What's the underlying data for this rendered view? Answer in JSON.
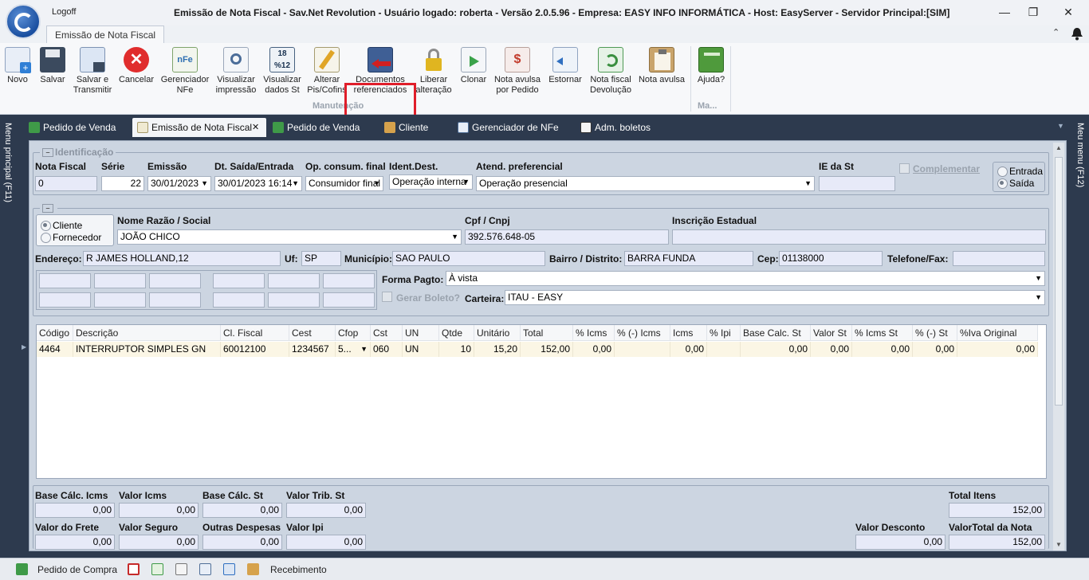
{
  "titlebar": {
    "logoff": "Logoff",
    "title": "Emissão de Nota Fiscal - Sav.Net Revolution - Usuário logado: roberta - Versão 2.0.5.96 - Empresa: EASY INFO INFORMÁTICA - Host: EasyServer - Servidor Principal:[SIM]",
    "minimize": "—",
    "restore": "❐",
    "close": "✕"
  },
  "ribbon": {
    "tab": "Emissão de Nota Fiscal",
    "collapse": "⌃",
    "buttons": [
      {
        "l1": "Novo",
        "l2": ""
      },
      {
        "l1": "Salvar",
        "l2": ""
      },
      {
        "l1": "Salvar e",
        "l2": "Transmitir"
      },
      {
        "l1": "Cancelar",
        "l2": ""
      },
      {
        "l1": "Gerenciador",
        "l2": "NFe"
      },
      {
        "l1": "Visualizar",
        "l2": "impressão"
      },
      {
        "l1": "Visualizar",
        "l2": "dados St"
      },
      {
        "l1": "Alterar",
        "l2": "Pis/Cofins"
      },
      {
        "l1": "Documentos",
        "l2": "referenciados"
      },
      {
        "l1": "Liberar",
        "l2": "alteração"
      },
      {
        "l1": "Clonar",
        "l2": ""
      },
      {
        "l1": "Nota avulsa",
        "l2": "por Pedido"
      },
      {
        "l1": "Estornar",
        "l2": ""
      },
      {
        "l1": "Nota fiscal",
        "l2": "Devolução"
      },
      {
        "l1": "Nota avulsa",
        "l2": ""
      },
      {
        "l1": "Ajuda?",
        "l2": ""
      }
    ],
    "groups": {
      "main": "Manutenção",
      "help": "Ma..."
    }
  },
  "doc_tabs": [
    {
      "label": "Pedido de Venda"
    },
    {
      "label": "Emissão de Nota Fiscal",
      "close": "✕"
    },
    {
      "label": "Pedido de Venda"
    },
    {
      "label": "Cliente"
    },
    {
      "label": "Gerenciador de NFe"
    },
    {
      "label": "Adm. boletos"
    }
  ],
  "side": {
    "left": "Menu principal (F11)",
    "right": "Meu menu (F12)"
  },
  "identificacao": {
    "legend": "Identificação",
    "nota_fiscal_label": "Nota Fiscal",
    "nota_fiscal": "0",
    "serie_label": "Série",
    "serie": "22",
    "emissao_label": "Emissão",
    "emissao": "30/01/2023",
    "saida_label": "Dt. Saída/Entrada",
    "saida": "30/01/2023 16:14",
    "op_consum_label": "Op. consum. final",
    "op_consum": "Consumidor final",
    "ident_dest_label": "Ident.Dest.",
    "ident_dest": "Operação interna",
    "atend_label": "Atend. preferencial",
    "atend": "Operação presencial",
    "ie_st_label": "IE da St",
    "ie_st": "",
    "complementar": "Complementar",
    "entrada": "Entrada",
    "saida_radio": "Saída"
  },
  "destinatario": {
    "cliente": "Cliente",
    "fornecedor": "Fornecedor",
    "nome_label": "Nome Razão / Social",
    "nome": "JOÃO CHICO",
    "cpf_label": "Cpf / Cnpj",
    "cpf": "392.576.648-05",
    "ie_label": "Inscrição Estadual",
    "ie": "",
    "endereco_label": "Endereço:",
    "endereco": "R JAMES HOLLAND,12",
    "uf_label": "Uf:",
    "uf": "SP",
    "municipio_label": "Município:",
    "municipio": "SAO PAULO",
    "bairro_label": "Bairro / Distrito:",
    "bairro": "BARRA FUNDA",
    "cep_label": "Cep:",
    "cep": "01138000",
    "telefone_label": "Telefone/Fax:",
    "telefone": "",
    "forma_label": "Forma Pagto:",
    "forma": "À vista",
    "gerar_boleto": "Gerar Boleto?",
    "carteira_label": "Carteira:",
    "carteira": "ITAU - EASY"
  },
  "grid": {
    "columns": [
      "Código",
      "Descrição",
      "Cl. Fiscal",
      "Cest",
      "Cfop",
      "Cst",
      "UN",
      "Qtde",
      "Unitário",
      "Total",
      "% Icms",
      "% (-) Icms",
      "Icms",
      "% Ipi",
      "Base Calc. St",
      "Valor St",
      "% Icms St",
      "% (-) St",
      "%Iva Original"
    ],
    "rows": [
      [
        "4464",
        "INTERRUPTOR SIMPLES GN",
        "60012100",
        "1234567",
        "5...",
        "060",
        "UN",
        "10",
        "15,20",
        "152,00",
        "0,00",
        "",
        "0,00",
        "",
        "0,00",
        "0,00",
        "0,00",
        "0,00",
        "0,00"
      ]
    ]
  },
  "totais": {
    "base_icms_label": "Base Cálc. Icms",
    "base_icms": "0,00",
    "valor_icms_label": "Valor Icms",
    "valor_icms": "0,00",
    "base_st_label": "Base Cálc. St",
    "base_st": "0,00",
    "valor_trib_label": "Valor Trib. St",
    "valor_trib": "0,00",
    "total_itens_label": "Total Itens",
    "total_itens": "152,00",
    "frete_label": "Valor do Frete",
    "frete": "0,00",
    "seguro_label": "Valor Seguro",
    "seguro": "0,00",
    "outras_label": "Outras Despesas",
    "outras": "0,00",
    "ipi_label": "Valor Ipi",
    "ipi": "0,00",
    "desconto_label": "Valor Desconto",
    "desconto": "0,00",
    "total_nota_label": "ValorTotal da Nota",
    "total_nota": "152,00"
  },
  "statusbar": {
    "pedido_compra": "Pedido de Compra",
    "recebimento": "Recebimento"
  },
  "colors": {
    "accent_red": "#e01e2a",
    "dark_band": "#2d3a4e",
    "panel": "#ccd5e1"
  }
}
